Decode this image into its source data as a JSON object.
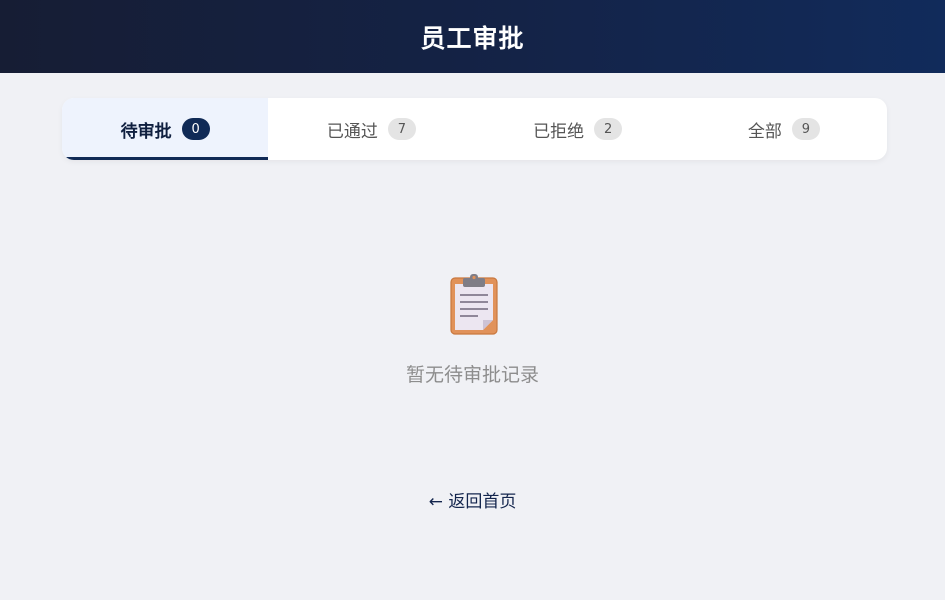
{
  "header": {
    "title": "员工审批"
  },
  "tabs": [
    {
      "label": "待审批",
      "count": "0",
      "active": true
    },
    {
      "label": "已通过",
      "count": "7",
      "active": false
    },
    {
      "label": "已拒绝",
      "count": "2",
      "active": false
    },
    {
      "label": "全部",
      "count": "9",
      "active": false
    }
  ],
  "empty_state": {
    "icon": "clipboard-icon",
    "message": "暂无待审批记录"
  },
  "back_link": {
    "label": "← 返回首页"
  },
  "colors": {
    "header_bg": "#142347",
    "accent": "#102a56",
    "page_bg": "#f0f1f5"
  }
}
